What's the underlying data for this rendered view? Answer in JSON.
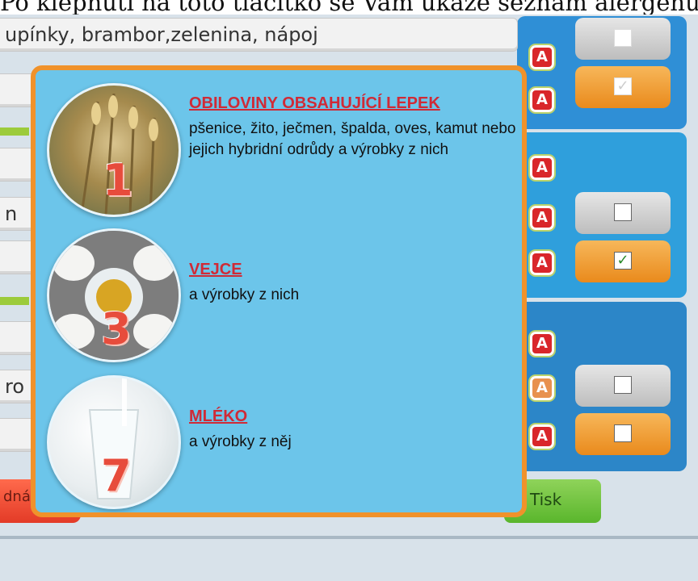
{
  "caption": "Po klepnutí na toto tlačítko se Vám ukáže seznam alergenů,",
  "background_rows": [
    "upínky, brambor,zelenina, nápoj",
    "",
    "",
    "n",
    "",
    "",
    "ro",
    ""
  ],
  "badge_letter": "A",
  "checkbox_mark": "✓",
  "buttons": {
    "order": "dnávku",
    "print": "Tisk"
  },
  "popup": {
    "items": [
      {
        "number": "1",
        "icon": "wheat-icon",
        "title": "OBILOVINY OBSAHUJÍCÍ LEPEK",
        "description": "pšenice, žito, ječmen, špalda, oves, kamut nebo jejich hybridní odrůdy a výrobky z nich"
      },
      {
        "number": "3",
        "icon": "egg-icon",
        "title": "VEJCE",
        "description": "a výrobky z nich"
      },
      {
        "number": "7",
        "icon": "milk-icon",
        "title": "MLÉKO",
        "description": "a výrobky z něj"
      }
    ]
  },
  "colors": {
    "popup_bg": "#6cc5ea",
    "popup_border": "#f0922b",
    "title_red": "#d02a36",
    "badge_red": "#d9262a",
    "print_green": "#6abf3a",
    "order_red": "#f0442c"
  }
}
